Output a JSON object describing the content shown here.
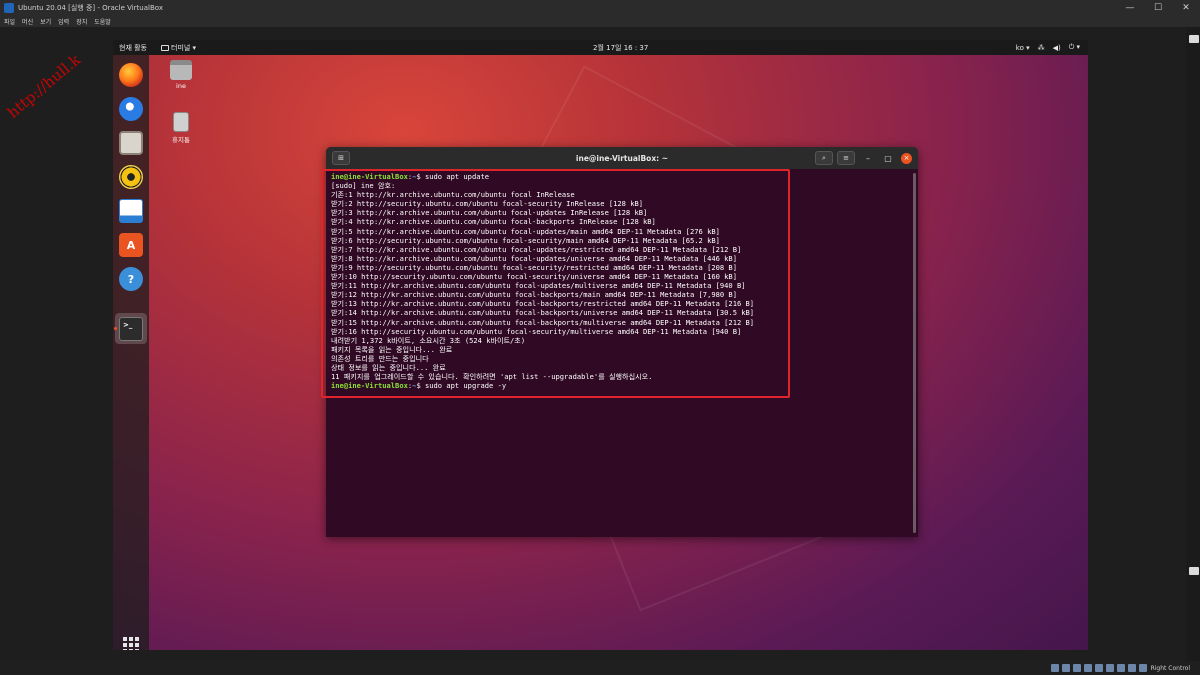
{
  "vbox": {
    "title": "Ubuntu 20.04 [실행 중] - Oracle VirtualBox",
    "menu": [
      "파일",
      "머신",
      "보기",
      "입력",
      "장치",
      "도움말"
    ],
    "status_text": "Right Control",
    "win_minimize": "—",
    "win_maximize": "☐",
    "win_close": "✕"
  },
  "watermark": "http://hull.k",
  "gnome": {
    "activities": "현재 활동",
    "app_menu": "터미널 ▾",
    "clock": "2월 17일  16 : 37",
    "lang": "ko ▾",
    "tray_icons": [
      "network-icon",
      "volume-icon",
      "power-icon"
    ]
  },
  "dock": {
    "apps": [
      {
        "name": "firefox-icon",
        "color": "#e66000"
      },
      {
        "name": "thunderbird-icon",
        "color": "#2a6fd6"
      },
      {
        "name": "files-icon",
        "color": "#d8d8d8"
      },
      {
        "name": "rhythmbox-icon",
        "color": "#f5c211"
      },
      {
        "name": "libreoffice-writer-icon",
        "color": "#2a7fd3"
      },
      {
        "name": "software-center-icon",
        "color": "#e95420"
      },
      {
        "name": "help-icon",
        "color": "#3b8fd8"
      },
      {
        "name": "terminal-icon",
        "color": "#2c2c2c"
      }
    ]
  },
  "desktop": {
    "home_label": "ine",
    "trash_label": "휴지통"
  },
  "terminal": {
    "title": "ine@ine-VirtualBox: ~",
    "prompt_user": "ine@ine-VirtualBox",
    "prompt_path": "~",
    "lines": [
      {
        "prompt": true,
        "cmd": "sudo apt update"
      },
      {
        "text": "[sudo] ine 암호:"
      },
      {
        "text": "기존:1 http://kr.archive.ubuntu.com/ubuntu focal InRelease"
      },
      {
        "text": "받기:2 http://security.ubuntu.com/ubuntu focal-security InRelease [128 kB]"
      },
      {
        "text": "받기:3 http://kr.archive.ubuntu.com/ubuntu focal-updates InRelease [128 kB]"
      },
      {
        "text": "받기:4 http://kr.archive.ubuntu.com/ubuntu focal-backports InRelease [128 kB]"
      },
      {
        "text": "받기:5 http://kr.archive.ubuntu.com/ubuntu focal-updates/main amd64 DEP-11 Metadata [276 kB]"
      },
      {
        "text": "받기:6 http://security.ubuntu.com/ubuntu focal-security/main amd64 DEP-11 Metadata [65.2 kB]"
      },
      {
        "text": "받기:7 http://kr.archive.ubuntu.com/ubuntu focal-updates/restricted amd64 DEP-11 Metadata [212 B]"
      },
      {
        "text": "받기:8 http://kr.archive.ubuntu.com/ubuntu focal-updates/universe amd64 DEP-11 Metadata [446 kB]"
      },
      {
        "text": "받기:9 http://security.ubuntu.com/ubuntu focal-security/restricted amd64 DEP-11 Metadata [208 B]"
      },
      {
        "text": "받기:10 http://security.ubuntu.com/ubuntu focal-security/universe amd64 DEP-11 Metadata [160 kB]"
      },
      {
        "text": "받기:11 http://kr.archive.ubuntu.com/ubuntu focal-updates/multiverse amd64 DEP-11 Metadata [940 B]"
      },
      {
        "text": "받기:12 http://kr.archive.ubuntu.com/ubuntu focal-backports/main amd64 DEP-11 Metadata [7,980 B]"
      },
      {
        "text": "받기:13 http://kr.archive.ubuntu.com/ubuntu focal-backports/restricted amd64 DEP-11 Metadata [216 B]"
      },
      {
        "text": "받기:14 http://kr.archive.ubuntu.com/ubuntu focal-backports/universe amd64 DEP-11 Metadata [30.5 kB]"
      },
      {
        "text": "받기:15 http://kr.archive.ubuntu.com/ubuntu focal-backports/multiverse amd64 DEP-11 Metadata [212 B]"
      },
      {
        "text": "받기:16 http://security.ubuntu.com/ubuntu focal-security/multiverse amd64 DEP-11 Metadata [940 B]"
      },
      {
        "text": "내려받기 1,372 k바이트, 소요시간 3초 (524 k바이트/초)"
      },
      {
        "text": "패키지 목록을 읽는 중입니다... 완료"
      },
      {
        "text": "의존성 트리를 만드는 중입니다"
      },
      {
        "text": "상태 정보를 읽는 중입니다... 완료"
      },
      {
        "text": "11 패키지를 업그레이드할 수 있습니다. 확인하려면 'apt list --upgradable'를 실행하십시오."
      },
      {
        "prompt": true,
        "cmd": "sudo apt upgrade -y"
      }
    ]
  },
  "colors": {
    "prompt_user": "#8ae234",
    "prompt_path": "#729fcf",
    "terminal_bg": "#300a24",
    "highlight": "#e0242b",
    "accent": "#e95420"
  }
}
